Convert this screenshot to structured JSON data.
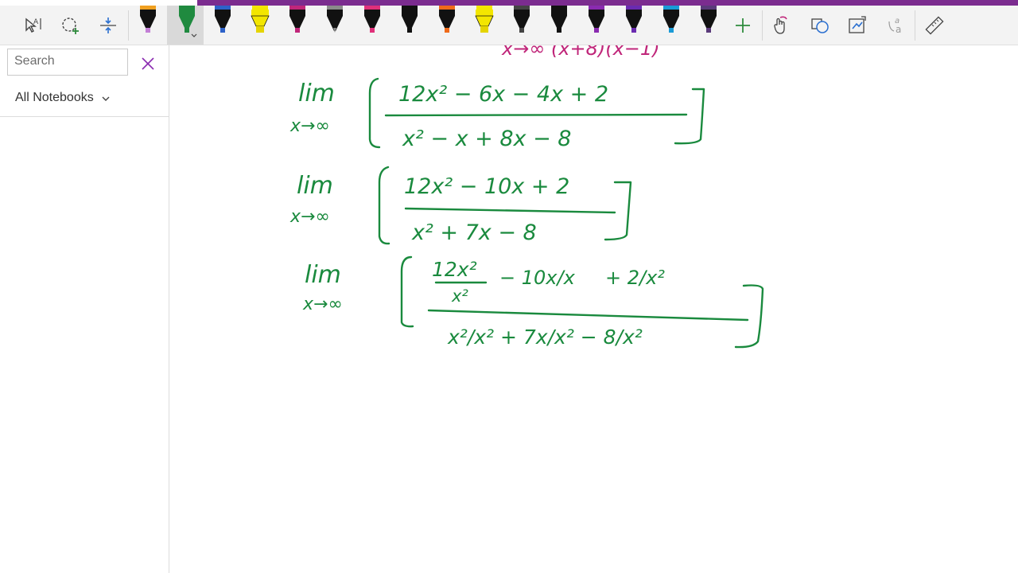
{
  "colors": {
    "accent_strip": "#7b2c8f",
    "toolbar_bg": "#f3f3f3",
    "ink_green": "#1a8a3e",
    "ink_magenta": "#c0267a",
    "add_pen": "#2e8b3d"
  },
  "toolbar": {
    "tools": [
      "lasso-select-icon",
      "add-space-icon",
      "insert-space-icon"
    ],
    "pens": [
      {
        "name": "pen-black-violet",
        "body": "#111111",
        "tip": "#111111",
        "cap": "#c37fd6",
        "band": "#f0a020"
      },
      {
        "name": "pen-green",
        "body": "#1f8a3f",
        "tip": "#1f8a3f",
        "cap": "#1f8a3f",
        "band": "#1f8a3f",
        "selected": true
      },
      {
        "name": "pen-blue",
        "body": "#111111",
        "tip": "#2d62c9",
        "cap": "#2d62c9",
        "band": "#2d62c9"
      },
      {
        "name": "highlighter-yellow",
        "body": "#f3e600",
        "tip": "#f3e600",
        "cap": "#f3e600",
        "band": "#f3e600",
        "highlighter": true
      },
      {
        "name": "pen-magenta",
        "body": "#111111",
        "tip": "#c0267a",
        "cap": "#c0267a",
        "band": "#c0267a"
      },
      {
        "name": "pencil-gray",
        "body": "#111111",
        "tip": "#8a8a8a",
        "cap": "#8a8a8a",
        "band": "#8a8a8a",
        "pencil": true
      },
      {
        "name": "pen-pink",
        "body": "#111111",
        "tip": "#e0307a",
        "cap": "#e0307a",
        "band": "#e0307a"
      },
      {
        "name": "pen-black",
        "body": "#111111",
        "tip": "#111111",
        "cap": "#111111",
        "band": "#111111"
      },
      {
        "name": "pen-orange",
        "body": "#111111",
        "tip": "#ef6a1a",
        "cap": "#ef6a1a",
        "band": "#ef6a1a"
      },
      {
        "name": "highlighter-yellow-2",
        "body": "#f3e600",
        "tip": "#f3e600",
        "cap": "#f3e600",
        "band": "#f3e600",
        "highlighter": true
      },
      {
        "name": "pen-dark-gray",
        "body": "#111111",
        "tip": "#333333",
        "cap": "#444444",
        "band": "#444444"
      },
      {
        "name": "pen-black-2",
        "body": "#111111",
        "tip": "#111111",
        "cap": "#111111",
        "band": "#111111"
      },
      {
        "name": "pen-purple",
        "body": "#111111",
        "tip": "#8a2bb0",
        "cap": "#8a2bb0",
        "band": "#8a2bb0"
      },
      {
        "name": "pen-violet",
        "body": "#111111",
        "tip": "#6a2bb0",
        "cap": "#6a2bb0",
        "band": "#6a2bb0"
      },
      {
        "name": "pen-cyan",
        "body": "#111111",
        "tip": "#1a9ad6",
        "cap": "#1a9ad6",
        "band": "#1a9ad6"
      },
      {
        "name": "pen-black-3",
        "body": "#111111",
        "tip": "#111111",
        "cap": "#5a3a7a",
        "band": "#5a3a7a"
      }
    ],
    "right_tools": [
      "add-pen-icon",
      "ink-to-shape-icon",
      "shapes-icon",
      "math-icon",
      "ink-to-text-icon",
      "ruler-icon"
    ]
  },
  "sidebar": {
    "search_placeholder": "Search",
    "notebooks_label": "All Notebooks"
  },
  "canvas": {
    "partial_top_line": "x→∞  (x+8)(x−1)",
    "step1": {
      "lim": "lim",
      "sub": "x→∞",
      "numerator": "12x² − 6x − 4x + 2",
      "denominator": "x² − x + 8x − 8"
    },
    "step2": {
      "lim": "lim",
      "sub": "x→∞",
      "numerator": "12x² − 10x + 2",
      "denominator": "x² + 7x − 8"
    },
    "step3": {
      "lim": "lim",
      "sub": "x→∞",
      "num_term1_top": "12x²",
      "num_term1_bottom": "x²",
      "num_term2": "− 10x/x",
      "num_term3": "+ 2/x²",
      "denominator": "x²/x² + 7x/x² − 8/x²"
    }
  }
}
